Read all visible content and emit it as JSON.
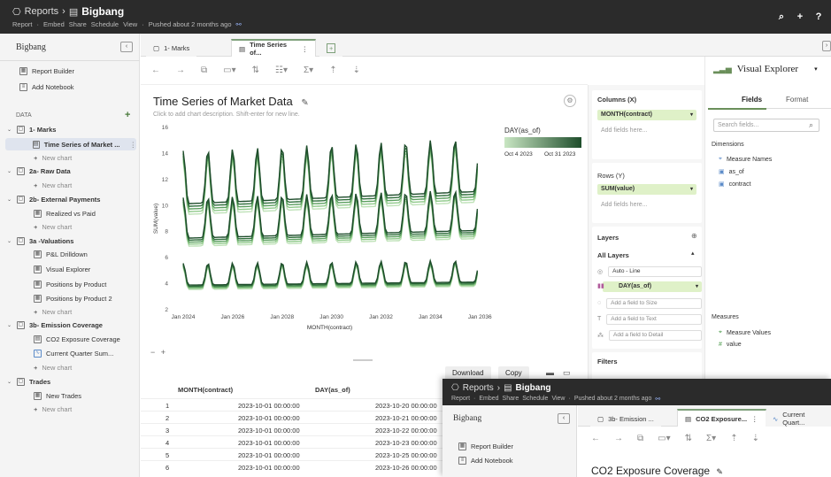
{
  "header": {
    "breadcrumb_root": "Reports",
    "breadcrumb_sep": "›",
    "workbook": "Bigbang",
    "menu": [
      "Report",
      "Embed",
      "Share",
      "Schedule",
      "View"
    ],
    "status": "Pushed about 2 months ago"
  },
  "sidebar": {
    "title": "Bigbang",
    "report_builder": "Report Builder",
    "add_notebook": "Add Notebook",
    "data_label": "DATA",
    "items": [
      {
        "label": "1- Marks"
      },
      {
        "label": "Time Series of Market ..."
      },
      {
        "label": "New chart"
      },
      {
        "label": "2a- Raw Data"
      },
      {
        "label": "New chart"
      },
      {
        "label": "2b- External Payments"
      },
      {
        "label": "Realized vs Paid"
      },
      {
        "label": "New chart"
      },
      {
        "label": "3a -Valuations"
      },
      {
        "label": "P&L Drilldown"
      },
      {
        "label": "Visual Explorer"
      },
      {
        "label": "Positions by Product"
      },
      {
        "label": "Positions by Product 2"
      },
      {
        "label": "New chart"
      },
      {
        "label": "3b- Emission Coverage"
      },
      {
        "label": "CO2 Exposure Coverage"
      },
      {
        "label": "Current Quarter Sum..."
      },
      {
        "label": "New chart"
      },
      {
        "label": "Trades"
      },
      {
        "label": "New Trades"
      },
      {
        "label": "New chart"
      }
    ]
  },
  "tabs": [
    {
      "label": "1- Marks"
    },
    {
      "label": "Time Series of..."
    }
  ],
  "chart": {
    "title": "Time Series of Market Data",
    "description": "Click to add chart description. Shift-enter for new line.",
    "legend_title": "DAY(as_of)",
    "legend_min": "Oct 4 2023",
    "legend_max": "Oct 31 2023"
  },
  "chart_data": {
    "type": "line",
    "title": "Time Series of Market Data",
    "xlabel": "MONTH(contract)",
    "ylabel": "SUM(value)",
    "x_ticks": [
      "Jan 2024",
      "Jan 2026",
      "Jan 2028",
      "Jan 2030",
      "Jan 2032",
      "Jan 2034",
      "Jan 2036"
    ],
    "y_ticks": [
      2,
      4,
      6,
      8,
      10,
      12,
      14,
      16
    ],
    "ylim": [
      2,
      16
    ],
    "xlim": [
      2023.75,
      2036.1
    ],
    "legend": "top-right",
    "color_scale": [
      "#c9e6c3",
      "#1e4d2b"
    ],
    "series": [
      {
        "base": 4.0,
        "amp": 1.4,
        "trend": 0.02
      },
      {
        "base": 7.7,
        "amp": 2.6,
        "trend": 0.05
      },
      {
        "base": 10.4,
        "amp": 3.4,
        "trend": 0.08
      }
    ]
  },
  "shelves": {
    "columns_label": "Columns (X)",
    "columns_pill": "MONTH(contract)",
    "rows_label": "Rows (Y)",
    "rows_pill": "SUM(value)",
    "add_fields": "Add fields here...",
    "layers_label": "Layers",
    "all_layers": "All Layers",
    "mark_type": "Auto - Line",
    "color_pill": "DAY(as_of)",
    "size_hint": "Add a field to Size",
    "text_hint": "Add a field to Text",
    "detail_hint": "Add a field to Detail",
    "filters_label": "Filters"
  },
  "right_panel": {
    "title": "Visual Explorer",
    "tab_fields": "Fields",
    "tab_format": "Format",
    "search_placeholder": "Search fields...",
    "dimensions_label": "Dimensions",
    "dimensions": [
      "Measure Names",
      "as_of",
      "contract"
    ],
    "measures_label": "Measures",
    "measures": [
      "Measure Values",
      "value"
    ]
  },
  "table": {
    "download": "Download",
    "copy": "Copy",
    "headers": [
      "MONTH(contract)",
      "DAY(as_of)"
    ],
    "rows": [
      {
        "n": "1",
        "month": "2023-10-01 00:00:00",
        "day": "2023-10-20 00:00:00"
      },
      {
        "n": "2",
        "month": "2023-10-01 00:00:00",
        "day": "2023-10-21 00:00:00"
      },
      {
        "n": "3",
        "month": "2023-10-01 00:00:00",
        "day": "2023-10-22 00:00:00"
      },
      {
        "n": "4",
        "month": "2023-10-01 00:00:00",
        "day": "2023-10-23 00:00:00"
      },
      {
        "n": "5",
        "month": "2023-10-01 00:00:00",
        "day": "2023-10-25 00:00:00"
      },
      {
        "n": "6",
        "month": "2023-10-01 00:00:00",
        "day": "2023-10-26 00:00:00"
      }
    ]
  },
  "overlay": {
    "breadcrumb_root": "Reports",
    "breadcrumb_sep": "›",
    "workbook": "Bigbang",
    "menu": [
      "Report",
      "Embed",
      "Share",
      "Schedule",
      "View"
    ],
    "status": "Pushed about 2 months ago",
    "sidebar_title": "Bigbang",
    "report_builder": "Report Builder",
    "add_notebook": "Add Notebook",
    "tabs": [
      "3b- Emission ...",
      "CO2 Exposure...",
      "Current Quart..."
    ],
    "chart_title": "CO2 Exposure Coverage"
  },
  "colors": {
    "accent": "#6a8f5a",
    "pill": "#dff1c8",
    "dark": "#2b2b2b"
  }
}
